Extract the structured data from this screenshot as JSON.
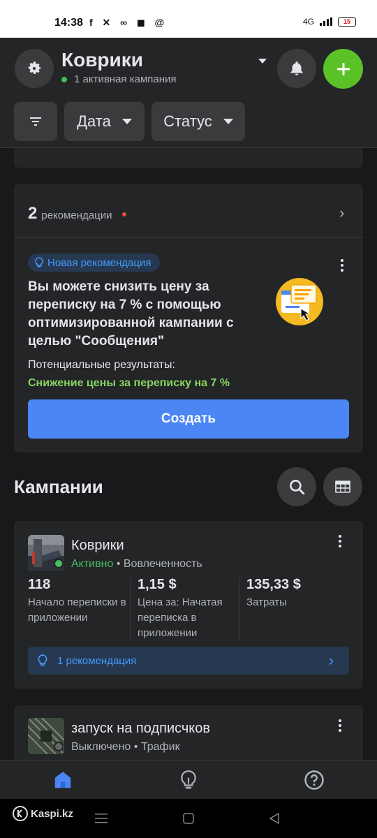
{
  "status_bar": {
    "time": "14:38",
    "apps": "f ✕ ∞ ◼ @",
    "network": "4G",
    "battery": "15"
  },
  "header": {
    "title": "Коврики",
    "subtitle": "1 активная кампания",
    "filters": {
      "date": "Дата",
      "status": "Статус"
    },
    "icons": {
      "settings": "gear-icon",
      "notifications": "bell-icon",
      "add": "plus-icon",
      "filter": "filter-icon"
    },
    "colors": {
      "add_button": "#5ac227",
      "active_dot": "#45bd62"
    }
  },
  "recommendations": {
    "count": "2",
    "label": "рекомендации",
    "badge": "Новая рекомендация",
    "text": "Вы можете снизить цену за переписку на 7 % с помощью оптимизированной кампании с целью \"Сообщения\"",
    "potential_label": "Потенциальные результаты:",
    "potential_value": "Снижение цены за переписку на 7 %",
    "cta": "Создать",
    "colors": {
      "cta": "#4c86f4",
      "potential": "#86d561",
      "badge_text": "#4599ff"
    }
  },
  "campaigns": {
    "title": "Кампании",
    "items": [
      {
        "name": "Коврики",
        "status": "Активно",
        "objective": "• Вовлеченность",
        "metrics": [
          {
            "value": "118",
            "label": "Начало переписки в приложении"
          },
          {
            "value": "1,15 $",
            "label": "Цена за: Начатая переписка в приложении"
          },
          {
            "value": "135,33 $",
            "label": "Затраты"
          }
        ],
        "recommendation": "1 рекомендация"
      },
      {
        "name": "запуск на подписчков",
        "status": "Выключено",
        "objective": "• Трафик"
      }
    ]
  },
  "bottom_nav": {
    "items": [
      {
        "icon": "home-icon",
        "selected": true
      },
      {
        "icon": "lightbulb-icon",
        "selected": false
      },
      {
        "icon": "help-icon",
        "selected": false
      }
    ]
  },
  "watermark": "Kaspi.kz"
}
